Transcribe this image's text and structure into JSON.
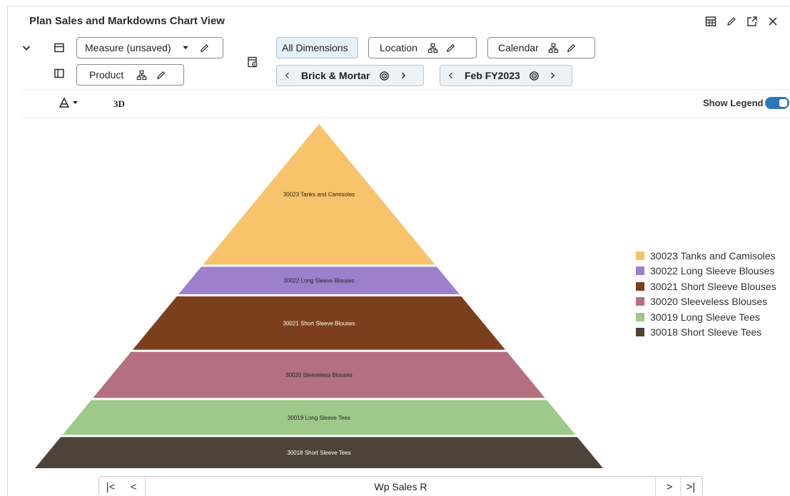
{
  "header": {
    "title": "Plan Sales and Markdowns Chart View",
    "icons": [
      "table-icon",
      "edit-icon",
      "expand-icon",
      "close-icon"
    ]
  },
  "toolbar": {
    "measure_label": "Measure (unsaved)",
    "product_label": "Product",
    "all_dimensions_label": "All Dimensions",
    "location_label": "Location",
    "calendar_label": "Calendar",
    "location_value": "Brick & Mortar",
    "calendar_value": "Feb FY2023",
    "mode_3d_label": "3D",
    "show_legend_label": "Show Legend",
    "show_legend_on": true
  },
  "pager": {
    "label": "Wp Sales R",
    "first": "|<",
    "prev": "<",
    "next": ">",
    "last": ">|"
  },
  "colors": {
    "accent": "#2b79bd",
    "selected_bg": "#e5f0f8"
  },
  "chart_data": {
    "type": "pyramid",
    "legend_position": "right",
    "segments": [
      {
        "name": "30023 Tanks and Camisoles",
        "color": "#f9c36b",
        "value": 38
      },
      {
        "name": "30022 Long Sleeve Blouses",
        "color": "#9e7fcc",
        "value": 8
      },
      {
        "name": "30021 Short Sleeve Blouses",
        "color": "#7c3f1e",
        "value": 15
      },
      {
        "name": "30020 Sleeveless Blouses",
        "color": "#b4707e",
        "value": 13
      },
      {
        "name": "30019 Long Sleeve Tees",
        "color": "#9ec98a",
        "value": 10
      },
      {
        "name": "30018 Short Sleeve Tees",
        "color": "#4d4339",
        "value": 9
      }
    ]
  }
}
